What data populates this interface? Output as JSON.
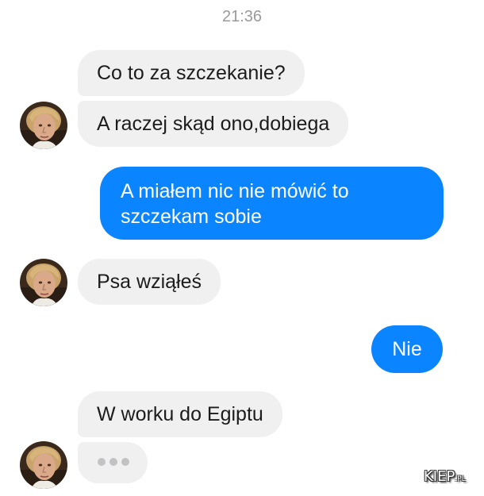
{
  "header": {
    "time": "21:36"
  },
  "messages": [
    {
      "sender": "them",
      "text": "Co to za szczekanie?"
    },
    {
      "sender": "them",
      "text": "A raczej skąd ono,dobiega"
    },
    {
      "sender": "me",
      "lines": [
        "A miałem nic nie mówić to",
        "szczekam sobie"
      ]
    },
    {
      "sender": "them",
      "text": "Psa wziąłeś"
    },
    {
      "sender": "me",
      "text": "Nie"
    },
    {
      "sender": "them",
      "text": "W worku do Egiptu"
    }
  ],
  "typing_indicator": {
    "icon": "typing-dots-icon"
  },
  "colors": {
    "outgoing_bubble": "#0a84ff",
    "incoming_bubble": "#f0f0f1",
    "timestamp": "#9a9a9a"
  },
  "watermark": {
    "text": "KIEP",
    "suffix": ".PL"
  }
}
